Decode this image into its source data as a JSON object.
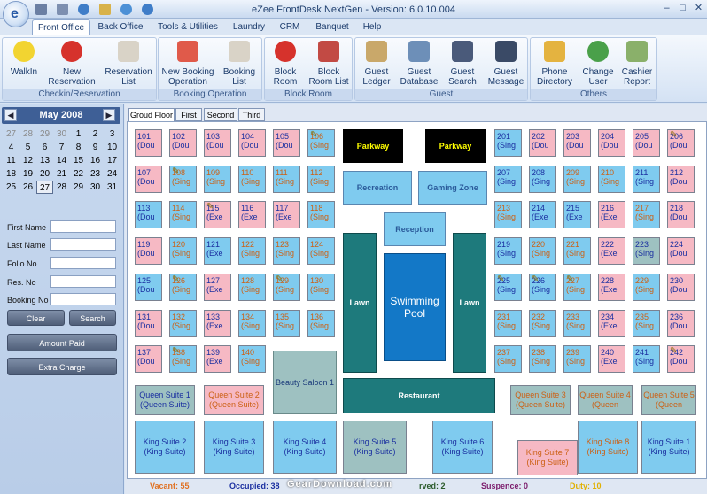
{
  "window": {
    "title": "eZee FrontDesk NextGen - Version: 6.0.10.004"
  },
  "menu": [
    "Front Office",
    "Back Office",
    "Tools & Utilities",
    "Laundry",
    "CRM",
    "Banquet",
    "Help"
  ],
  "ribbon": {
    "groups": [
      {
        "label": "Checkin/Reservation",
        "buttons": [
          {
            "label": "WalkIn",
            "icon": "walkin-icon"
          },
          {
            "label": "New\nReservation",
            "icon": "new-reservation-icon"
          },
          {
            "label": "Reservation\nList",
            "icon": "reservation-list-icon"
          }
        ]
      },
      {
        "label": "Booking Operation",
        "buttons": [
          {
            "label": "New Booking\nOperation",
            "icon": "new-booking-icon"
          },
          {
            "label": "Booking\nList",
            "icon": "booking-list-icon"
          }
        ]
      },
      {
        "label": "Block Room",
        "buttons": [
          {
            "label": "Block\nRoom",
            "icon": "block-room-icon"
          },
          {
            "label": "Block\nRoom List",
            "icon": "block-room-list-icon"
          }
        ]
      },
      {
        "label": "Guest",
        "buttons": [
          {
            "label": "Guest\nLedger",
            "icon": "guest-ledger-icon"
          },
          {
            "label": "Guest\nDatabase",
            "icon": "guest-database-icon"
          },
          {
            "label": "Guest\nSearch",
            "icon": "guest-search-icon"
          },
          {
            "label": "Guest\nMessage",
            "icon": "guest-message-icon"
          }
        ]
      },
      {
        "label": "Others",
        "buttons": [
          {
            "label": "Phone\nDirectory",
            "icon": "phone-directory-icon"
          },
          {
            "label": "Change\nUser",
            "icon": "change-user-icon"
          },
          {
            "label": "Cashier\nReport",
            "icon": "cashier-report-icon"
          }
        ]
      }
    ]
  },
  "calendar": {
    "month": "May 2008",
    "days": [
      "27",
      "28",
      "29",
      "30",
      "1",
      "2",
      "3",
      "4",
      "5",
      "6",
      "7",
      "8",
      "9",
      "10",
      "11",
      "12",
      "13",
      "14",
      "15",
      "16",
      "17",
      "18",
      "19",
      "20",
      "21",
      "22",
      "23",
      "24",
      "25",
      "26",
      "27",
      "28",
      "29",
      "30",
      "31"
    ],
    "other_month": [
      0,
      1,
      2,
      3
    ],
    "today_index": 30
  },
  "search": {
    "fields": [
      "First Name",
      "Last Name",
      "Folio No",
      "Res. No",
      "Booking No"
    ],
    "clear": "Clear",
    "search": "Search",
    "amount_paid": "Amount Paid",
    "extra_charge": "Extra Charge"
  },
  "floor_tabs": [
    "Groud Floor",
    "First",
    "Second",
    "Third"
  ],
  "rooms": [
    {
      "no": "101",
      "type": "(Dou",
      "s": "o"
    },
    {
      "no": "102",
      "type": "(Dou",
      "s": "o"
    },
    {
      "no": "103",
      "type": "(Dou",
      "s": "o"
    },
    {
      "no": "104",
      "type": "(Dou",
      "s": "o"
    },
    {
      "no": "105",
      "type": "(Dou",
      "s": "o"
    },
    {
      "no": "106",
      "type": "(Sing",
      "s": "v",
      "dirty": true
    },
    {
      "no": "107",
      "type": "(Dou",
      "s": "o"
    },
    {
      "no": "108",
      "type": "(Sing",
      "s": "v",
      "dirty": true
    },
    {
      "no": "109",
      "type": "(Sing",
      "s": "v"
    },
    {
      "no": "110",
      "type": "(Sing",
      "s": "v"
    },
    {
      "no": "111",
      "type": "(Sing",
      "s": "v"
    },
    {
      "no": "112",
      "type": "(Sing",
      "s": "v"
    },
    {
      "no": "113",
      "type": "(Dou",
      "s": "d"
    },
    {
      "no": "114",
      "type": "(Sing",
      "s": "v"
    },
    {
      "no": "115",
      "type": "(Exe",
      "s": "o",
      "dirty": true
    },
    {
      "no": "116",
      "type": "(Exe",
      "s": "o"
    },
    {
      "no": "117",
      "type": "(Exe",
      "s": "o"
    },
    {
      "no": "118",
      "type": "(Sing",
      "s": "v"
    },
    {
      "no": "119",
      "type": "(Dou",
      "s": "o"
    },
    {
      "no": "120",
      "type": "(Sing",
      "s": "v"
    },
    {
      "no": "121",
      "type": "(Exe",
      "s": "d"
    },
    {
      "no": "122",
      "type": "(Sing",
      "s": "v"
    },
    {
      "no": "123",
      "type": "(Sing",
      "s": "v"
    },
    {
      "no": "124",
      "type": "(Sing",
      "s": "v"
    },
    {
      "no": "125",
      "type": "(Dou",
      "s": "d"
    },
    {
      "no": "126",
      "type": "(Sing",
      "s": "v",
      "dirty": true
    },
    {
      "no": "127",
      "type": "(Exe",
      "s": "o"
    },
    {
      "no": "128",
      "type": "(Sing",
      "s": "v"
    },
    {
      "no": "129",
      "type": "(Sing",
      "s": "v",
      "dirty": true
    },
    {
      "no": "130",
      "type": "(Sing",
      "s": "v"
    },
    {
      "no": "131",
      "type": "(Dou",
      "s": "o"
    },
    {
      "no": "132",
      "type": "(Sing",
      "s": "v"
    },
    {
      "no": "133",
      "type": "(Exe",
      "s": "o"
    },
    {
      "no": "134",
      "type": "(Sing",
      "s": "v"
    },
    {
      "no": "135",
      "type": "(Sing",
      "s": "v"
    },
    {
      "no": "136",
      "type": "(Sing",
      "s": "v"
    },
    {
      "no": "137",
      "type": "(Dou",
      "s": "o"
    },
    {
      "no": "138",
      "type": "(Sing",
      "s": "v",
      "dirty": true
    },
    {
      "no": "139",
      "type": "(Exe",
      "s": "o"
    },
    {
      "no": "140",
      "type": "(Sing",
      "s": "v"
    }
  ],
  "rooms_right": [
    {
      "no": "201",
      "type": "(Sing",
      "s": "d"
    },
    {
      "no": "202",
      "type": "(Dou",
      "s": "o"
    },
    {
      "no": "203",
      "type": "(Dou",
      "s": "o"
    },
    {
      "no": "204",
      "type": "(Dou",
      "s": "o"
    },
    {
      "no": "205",
      "type": "(Dou",
      "s": "o"
    },
    {
      "no": "206",
      "type": "(Dou",
      "s": "o",
      "dirty": true
    },
    {
      "no": "207",
      "type": "(Sing",
      "s": "d"
    },
    {
      "no": "208",
      "type": "(Sing",
      "s": "d"
    },
    {
      "no": "209",
      "type": "(Sing",
      "s": "v"
    },
    {
      "no": "210",
      "type": "(Sing",
      "s": "v"
    },
    {
      "no": "211",
      "type": "(Sing",
      "s": "d"
    },
    {
      "no": "212",
      "type": "(Dou",
      "s": "o"
    },
    {
      "no": "213",
      "type": "(Sing",
      "s": "v"
    },
    {
      "no": "214",
      "type": "(Exe",
      "s": "d"
    },
    {
      "no": "215",
      "type": "(Exe",
      "s": "d"
    },
    {
      "no": "216",
      "type": "(Exe",
      "s": "o"
    },
    {
      "no": "217",
      "type": "(Sing",
      "s": "v"
    },
    {
      "no": "218",
      "type": "(Dou",
      "s": "o"
    },
    {
      "no": "219",
      "type": "(Sing",
      "s": "d"
    },
    {
      "no": "220",
      "type": "(Sing",
      "s": "v"
    },
    {
      "no": "221",
      "type": "(Sing",
      "s": "v"
    },
    {
      "no": "222",
      "type": "(Exe",
      "s": "o"
    },
    {
      "no": "223",
      "type": "(Sing",
      "s": "g"
    },
    {
      "no": "224",
      "type": "(Dou",
      "s": "o"
    },
    {
      "no": "225",
      "type": "(Sing",
      "s": "d",
      "dirty": true
    },
    {
      "no": "226",
      "type": "(Sing",
      "s": "d",
      "dirty": true
    },
    {
      "no": "227",
      "type": "(Sing",
      "s": "v",
      "dirty": true
    },
    {
      "no": "228",
      "type": "(Exe",
      "s": "o"
    },
    {
      "no": "229",
      "type": "(Sing",
      "s": "v"
    },
    {
      "no": "230",
      "type": "(Dou",
      "s": "o"
    },
    {
      "no": "231",
      "type": "(Sing",
      "s": "v"
    },
    {
      "no": "232",
      "type": "(Sing",
      "s": "v"
    },
    {
      "no": "233",
      "type": "(Sing",
      "s": "v"
    },
    {
      "no": "234",
      "type": "(Exe",
      "s": "o"
    },
    {
      "no": "235",
      "type": "(Sing",
      "s": "v"
    },
    {
      "no": "236",
      "type": "(Dou",
      "s": "o"
    },
    {
      "no": "237",
      "type": "(Sing",
      "s": "v"
    },
    {
      "no": "238",
      "type": "(Sing",
      "s": "v"
    },
    {
      "no": "239",
      "type": "(Sing",
      "s": "v"
    },
    {
      "no": "240",
      "type": "(Exe",
      "s": "o"
    },
    {
      "no": "241",
      "type": "(Sing",
      "s": "d"
    },
    {
      "no": "242",
      "type": "(Dou",
      "s": "o",
      "dirty": true
    }
  ],
  "facilities": {
    "parkway1": "Parkway",
    "parkway2": "Parkway",
    "recreation": "Recreation",
    "gaming": "Gaming Zone",
    "reception": "Reception",
    "lawn1": "Lawn",
    "lawn2": "Lawn",
    "pool": "Swimming Pool",
    "beauty": "Beauty Saloon 1",
    "restaurant": "Restaurant"
  },
  "suites": [
    {
      "n": "Queen Suite 1",
      "t": "(Queen Suite)",
      "c": "gray"
    },
    {
      "n": "Queen Suite 2",
      "t": "(Queen Suite)",
      "c": "qo"
    },
    {
      "n": "Queen Suite 3",
      "t": "(Queen Suite)",
      "c": "grayo"
    },
    {
      "n": "Queen Suite 4",
      "t": "(Queen",
      "c": "grayo"
    },
    {
      "n": "Queen Suite 5",
      "t": "(Queen",
      "c": "grayo"
    },
    {
      "n": "King Suite 2",
      "t": "(King Suite)",
      "c": "sky"
    },
    {
      "n": "King Suite 3",
      "t": "(King Suite)",
      "c": "sky"
    },
    {
      "n": "King Suite 4",
      "t": "(King Suite)",
      "c": "sky"
    },
    {
      "n": "King Suite 5",
      "t": "(King Suite)",
      "c": "gray"
    },
    {
      "n": "King Suite 6",
      "t": "(King Suite)",
      "c": "sky"
    },
    {
      "n": "King Suite 7",
      "t": "(King Suite)",
      "c": "pinko"
    },
    {
      "n": "King Suite 8",
      "t": "(King Suite)",
      "c": "skyo"
    },
    {
      "n": "King Suite 1",
      "t": "(King Suite)",
      "c": "sky"
    }
  ],
  "status": {
    "vacant": "Vacant: 55",
    "occupied": "Occupied: 38",
    "reserved": "rved: 2",
    "suspence": "Suspence: 0",
    "duty": "Duty: 10",
    "watermark": "GearDownload.com"
  }
}
